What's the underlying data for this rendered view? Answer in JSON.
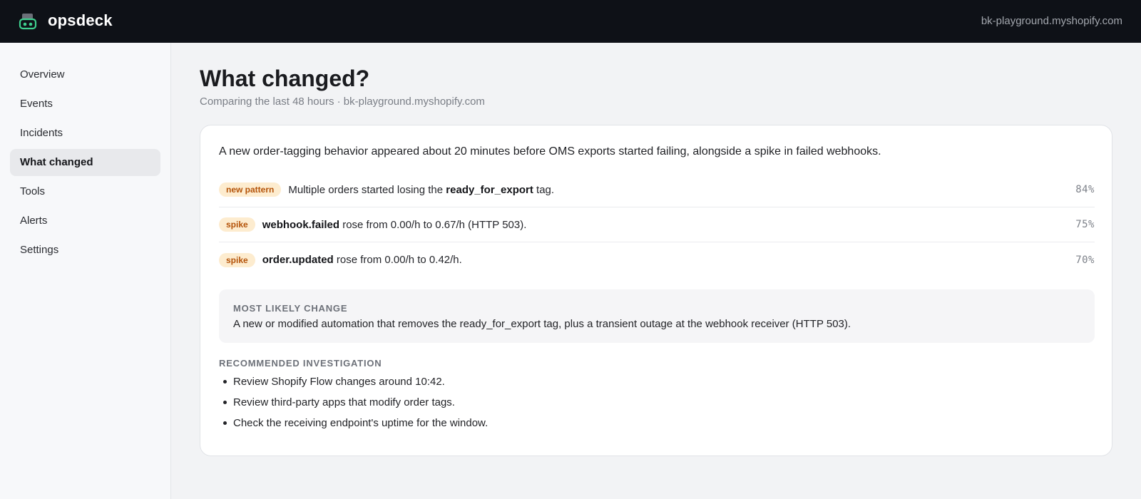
{
  "header": {
    "brand_name": "opsdeck",
    "store_domain": "bk-playground.myshopify.com",
    "logo_icon": "robot-logo-icon",
    "accent_color": "#3ecf8e"
  },
  "sidebar": {
    "items": [
      {
        "label": "Overview",
        "active": false
      },
      {
        "label": "Events",
        "active": false
      },
      {
        "label": "Incidents",
        "active": false
      },
      {
        "label": "What changed",
        "active": true
      },
      {
        "label": "Tools",
        "active": false
      },
      {
        "label": "Alerts",
        "active": false
      },
      {
        "label": "Settings",
        "active": false
      }
    ]
  },
  "main": {
    "title": "What changed?",
    "subtitle": "Comparing the last 48 hours · bk-playground.myshopify.com",
    "summary": "A new order-tagging behavior appeared about 20 minutes before OMS exports started failing, alongside a spike in failed webhooks.",
    "findings": [
      {
        "badge": "new pattern",
        "pre": "Multiple orders started losing the ",
        "strong": "ready_for_export",
        "post": " tag.",
        "confidence": "84%"
      },
      {
        "badge": "spike",
        "pre": "",
        "strong": "webhook.failed",
        "post": " rose from 0.00/h to 0.67/h (HTTP 503).",
        "confidence": "75%"
      },
      {
        "badge": "spike",
        "pre": "",
        "strong": "order.updated",
        "post": " rose from 0.00/h to 0.42/h.",
        "confidence": "70%"
      }
    ],
    "most_likely": {
      "label": "MOST LIKELY CHANGE",
      "text": "A new or modified automation that removes the ready_for_export tag, plus a transient outage at the webhook receiver (HTTP 503)."
    },
    "recommended": {
      "label": "RECOMMENDED INVESTIGATION",
      "items": [
        "Review Shopify Flow changes around 10:42.",
        "Review third-party apps that modify order tags.",
        "Check the receiving endpoint's uptime for the window."
      ]
    }
  }
}
